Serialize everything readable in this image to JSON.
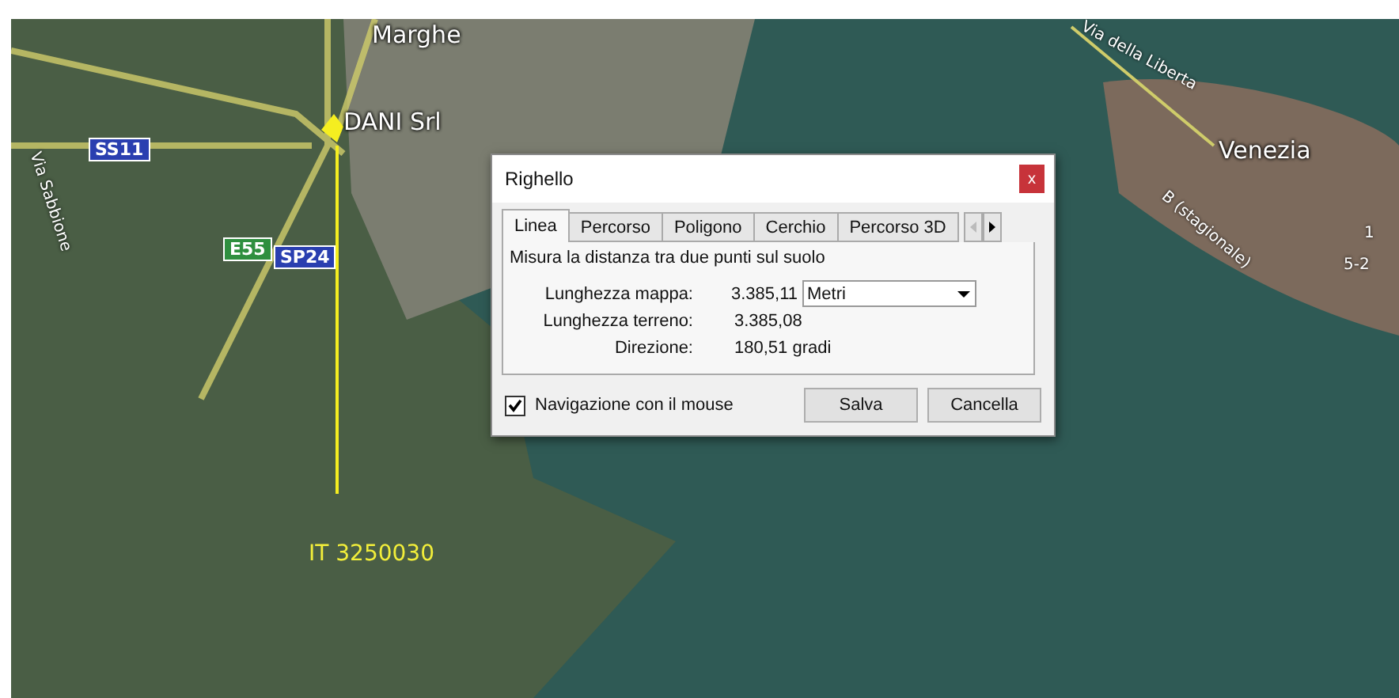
{
  "map": {
    "labels": [
      {
        "kind": "place",
        "text": "Marghe"
      },
      {
        "kind": "place",
        "text": "DANI Srl"
      },
      {
        "kind": "shield",
        "text": "SS11",
        "color": "#2a3fb0"
      },
      {
        "kind": "street",
        "text": "Via Sabbione"
      },
      {
        "kind": "shield",
        "text": "E55",
        "color": "#2f8f3f"
      },
      {
        "kind": "shield",
        "text": "SP24",
        "color": "#2a3fb0"
      },
      {
        "kind": "street",
        "text": "Via della Liberta"
      },
      {
        "kind": "place",
        "text": "Venezia"
      },
      {
        "kind": "street",
        "text": "B (stagionale)"
      },
      {
        "kind": "street",
        "text": "1"
      },
      {
        "kind": "street",
        "text": "5-2"
      },
      {
        "kind": "area",
        "text": "IT 3250030"
      }
    ]
  },
  "dialog": {
    "title": "Righello",
    "close": "x",
    "tabs": [
      {
        "label": "Linea",
        "selected": true
      },
      {
        "label": "Percorso",
        "selected": false
      },
      {
        "label": "Poligono",
        "selected": false
      },
      {
        "label": "Cerchio",
        "selected": false
      },
      {
        "label": "Percorso 3D",
        "selected": false
      }
    ],
    "description": "Misura la distanza tra due punti sul suolo",
    "rows": [
      {
        "label": "Lunghezza mappa:",
        "value": "3.385,11",
        "unit": "Metri"
      },
      {
        "label": "Lunghezza terreno:",
        "value": "3.385,08"
      },
      {
        "label": "Direzione:",
        "value": "180,51 gradi"
      }
    ],
    "checkbox": {
      "label": "Navigazione con il mouse",
      "checked": true
    },
    "buttons": [
      "Salva",
      "Cancella"
    ]
  }
}
